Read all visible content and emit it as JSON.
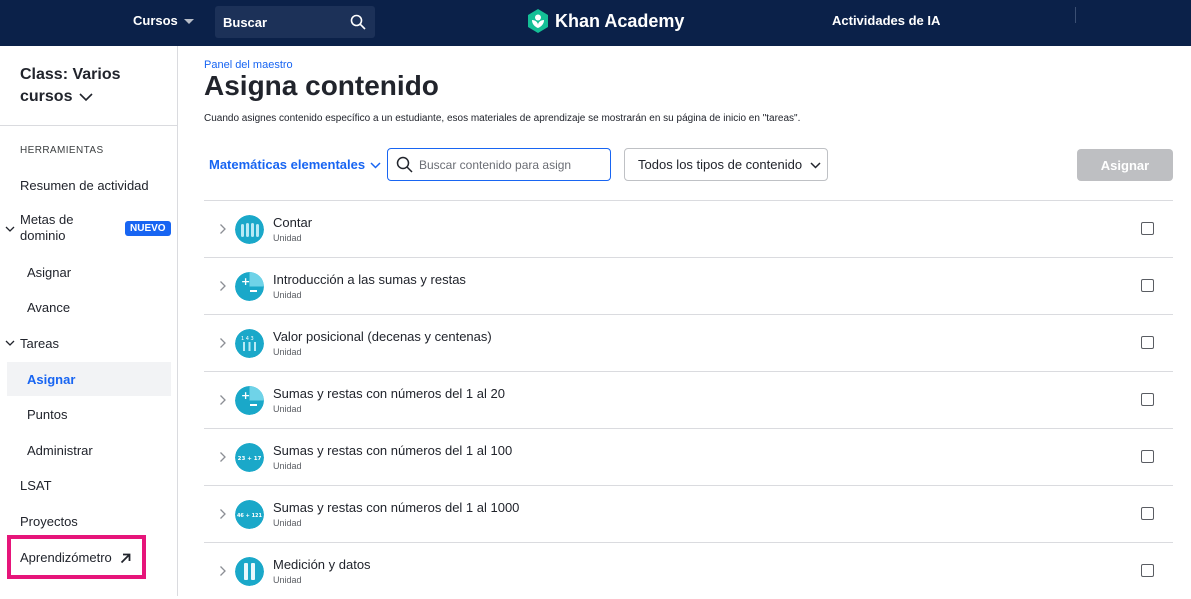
{
  "topnav": {
    "courses_label": "Cursos",
    "search_label": "Buscar",
    "logo_text": "Khan Academy",
    "ai_label": "Actividades de IA"
  },
  "sidebar": {
    "class_title": "Class: Varios cursos",
    "section_header": "HERRAMIENTAS",
    "items": {
      "activity_summary": "Resumen de actividad",
      "mastery_goals": "Metas de dominio",
      "new_badge": "NUEVO",
      "mastery_assign": "Asignar",
      "mastery_progress": "Avance",
      "assignments": "Tareas",
      "assignments_assign": "Asignar",
      "assignments_scores": "Puntos",
      "assignments_manage": "Administrar",
      "lsat": "LSAT",
      "projects": "Proyectos",
      "learning_meter": "Aprendizómetro"
    }
  },
  "main": {
    "breadcrumb": "Panel del maestro",
    "title": "Asigna contenido",
    "description": "Cuando asignes contenido específico a un estudiante, esos materiales de aprendizaje se mostrarán en su página de inicio en \"tareas\".",
    "subject_label": "Matemáticas elementales",
    "search_placeholder": "Buscar contenido para asign",
    "type_filter": "Todos los tipos de contenido",
    "assign_button": "Asignar",
    "units": [
      {
        "title": "Contar",
        "kind": "Unidad",
        "icon": "counting-icon",
        "checked": false
      },
      {
        "title": "Introducción a las sumas y restas",
        "kind": "Unidad",
        "icon": "plus-minus-icon",
        "checked": false
      },
      {
        "title": "Valor posicional (decenas y centenas)",
        "kind": "Unidad",
        "icon": "place-value-icon",
        "checked": false
      },
      {
        "title": "Sumas y restas con números del 1 al 20",
        "kind": "Unidad",
        "icon": "plus-minus-icon",
        "checked": false
      },
      {
        "title": "Sumas y restas con números del 1 al 100",
        "kind": "Unidad",
        "icon": "sum-23-17-icon",
        "checked": false
      },
      {
        "title": "Sumas y restas con números del 1 al 1000",
        "kind": "Unidad",
        "icon": "sum-46-121-icon",
        "checked": false
      },
      {
        "title": "Medición y datos",
        "kind": "Unidad",
        "icon": "measurement-icon",
        "checked": false
      }
    ]
  },
  "colors": {
    "nav_bg": "#0b2149",
    "accent_blue": "#1865f2",
    "highlight_pink": "#e6157a",
    "unit_icon_teal": "#1aa8c9"
  }
}
